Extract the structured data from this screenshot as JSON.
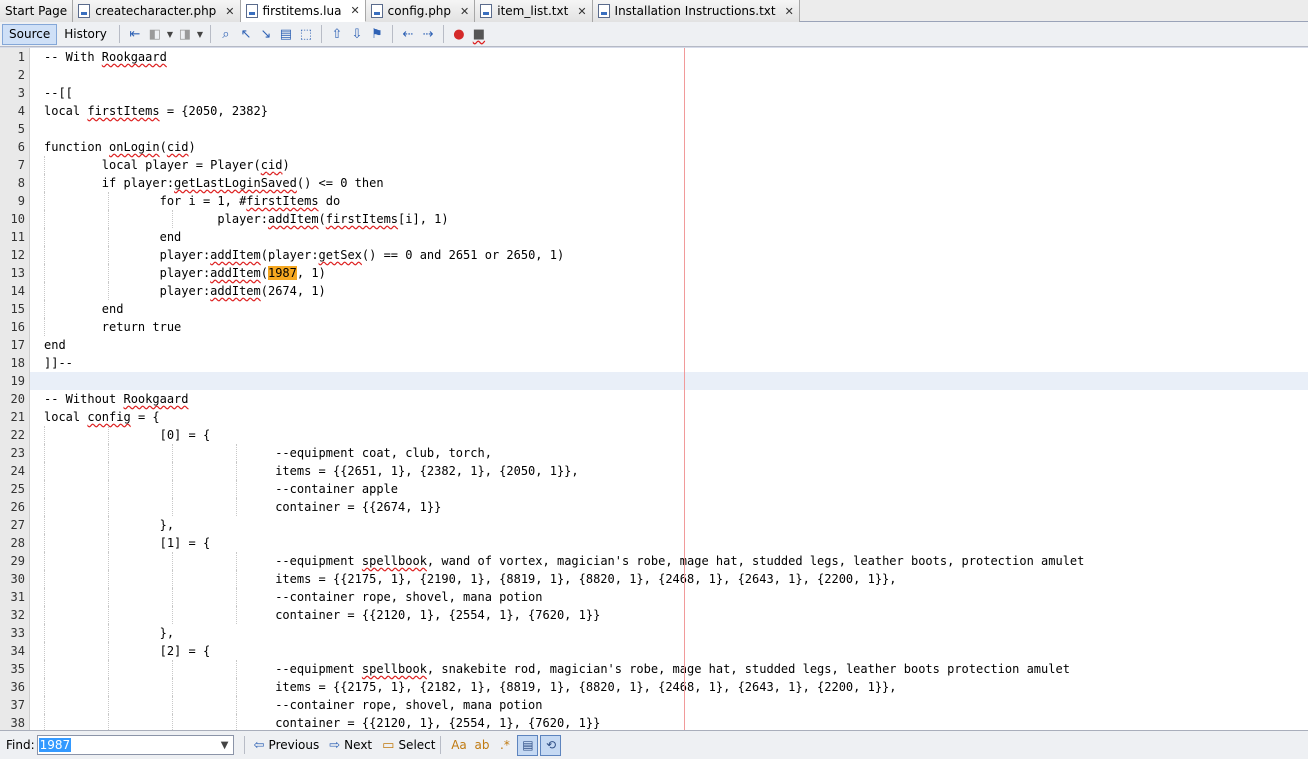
{
  "tabs": [
    {
      "label": "Start Page",
      "close": "",
      "icon": false,
      "active": false
    },
    {
      "label": "createcharacter.php",
      "close": "✕",
      "icon": true,
      "active": false
    },
    {
      "label": "firstitems.lua",
      "close": "✕",
      "icon": true,
      "active": true
    },
    {
      "label": "config.php",
      "close": "✕",
      "icon": true,
      "active": false
    },
    {
      "label": "item_list.txt",
      "close": "✕",
      "icon": true,
      "active": false
    },
    {
      "label": "Installation Instructions.txt",
      "close": "✕",
      "icon": true,
      "active": false
    }
  ],
  "toolbar": {
    "source_label": "Source",
    "history_label": "History"
  },
  "code_lines": [
    "-- With Rookgaard",
    "",
    "--[[",
    "local firstItems = {2050, 2382}",
    "",
    "function onLogin(cid)",
    "\tlocal player = Player(cid)",
    "\tif player:getLastLoginSaved() <= 0 then",
    "\t\tfor i = 1, #firstItems do",
    "\t\t\tplayer:addItem(firstItems[i], 1)",
    "\t\tend",
    "\t\tplayer:addItem(player:getSex() == 0 and 2651 or 2650, 1)",
    "\t\tplayer:addItem(1987, 1)",
    "\t\tplayer:addItem(2674, 1)",
    "\tend",
    "\treturn true",
    "end",
    "]]--",
    "",
    "-- Without Rookgaard",
    "local config = {",
    "\t\t[0] = {",
    "\t\t\t\t--equipment coat, club, torch,",
    "\t\t\t\titems = {{2651, 1}, {2382, 1}, {2050, 1}},",
    "\t\t\t\t--container apple",
    "\t\t\t\tcontainer = {{2674, 1}}",
    "\t\t},",
    "\t\t[1] = {",
    "\t\t\t\t--equipment spellbook, wand of vortex, magician's robe, mage hat, studded legs, leather boots, protection amulet",
    "\t\t\t\titems = {{2175, 1}, {2190, 1}, {8819, 1}, {8820, 1}, {2468, 1}, {2643, 1}, {2200, 1}},",
    "\t\t\t\t--container rope, shovel, mana potion",
    "\t\t\t\tcontainer = {{2120, 1}, {2554, 1}, {7620, 1}}",
    "\t\t},",
    "\t\t[2] = {",
    "\t\t\t\t--equipment spellbook, snakebite rod, magician's robe, mage hat, studded legs, leather boots protection amulet",
    "\t\t\t\titems = {{2175, 1}, {2182, 1}, {8819, 1}, {8820, 1}, {2468, 1}, {2643, 1}, {2200, 1}},",
    "\t\t\t\t--container rope, shovel, mana potion",
    "\t\t\t\tcontainer = {{2120, 1}, {2554, 1}, {7620, 1}}"
  ],
  "current_line": 19,
  "squiggles": [
    "Rookgaard",
    "firstItems",
    "onLogin",
    "cid",
    "getLastLoginSaved",
    "addItem",
    "getSex",
    "config",
    "spellbook"
  ],
  "search_highlight": "1987",
  "find": {
    "label": "Find:",
    "value": "1987",
    "previous_label": "Previous",
    "next_label": "Next",
    "select_label": "Select"
  },
  "colors": {
    "highlight": "#f6a821",
    "margin_line": "#f19a9a",
    "current_line": "#e9eff8"
  }
}
